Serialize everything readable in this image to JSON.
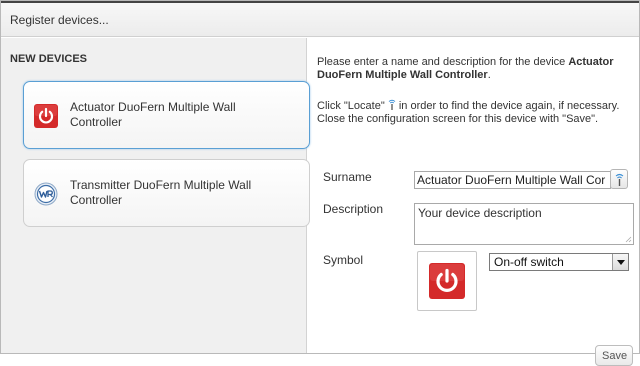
{
  "window": {
    "title": "Register devices..."
  },
  "left_panel": {
    "section_title": "NEW DEVICES",
    "devices": [
      {
        "label": "Actuator DuoFern Multiple Wall Controller",
        "icon": "power-icon",
        "selected": true
      },
      {
        "label": "Transmitter DuoFern Multiple Wall Controller",
        "icon": "wr-logo-icon",
        "selected": false
      }
    ]
  },
  "form": {
    "intro_text": "Please enter a name and description for the device",
    "device_name": "Actuator DuoFern Multiple Wall Controller",
    "intro_suffix": ".",
    "hint_before": "Click \"Locate\"",
    "hint_after": " in order to find the device again, if necessary. Close the configuration screen for this device with \"Save\".",
    "surname_label": "Surname",
    "surname_value": "Actuator DuoFern Multiple Wall Cor",
    "description_label": "Description",
    "description_value": "Your device description",
    "symbol_label": "Symbol",
    "symbol_selected": "On-off switch",
    "save_label": "Save"
  },
  "colors": {
    "accent_red": "#d42a2a",
    "selection_border": "#5a9fd4",
    "locate_blue": "#3b8fd6"
  }
}
